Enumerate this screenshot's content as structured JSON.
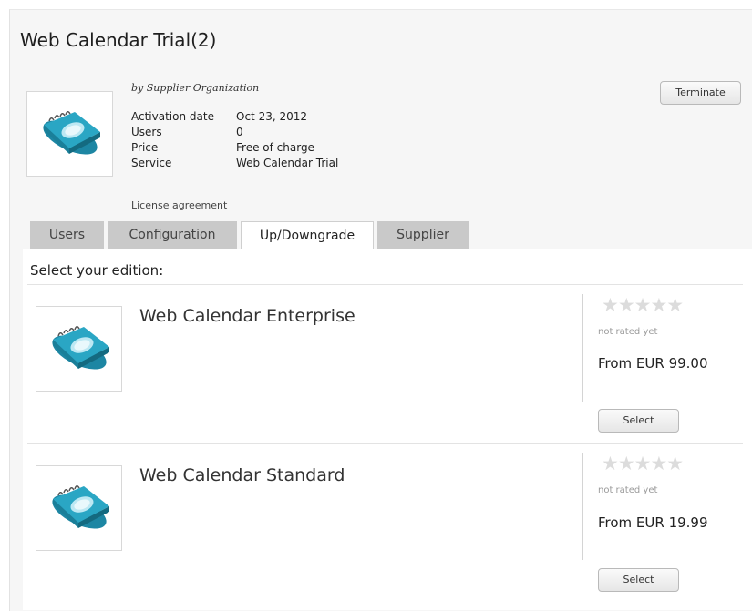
{
  "header": {
    "title": "Web Calendar Trial(2)"
  },
  "subscription": {
    "supplier_line": "by Supplier Organization",
    "fields": [
      {
        "label": "Activation date",
        "value": "Oct 23, 2012"
      },
      {
        "label": "Users",
        "value": "0"
      },
      {
        "label": "Price",
        "value": "Free of charge"
      },
      {
        "label": "Service",
        "value": "Web Calendar Trial"
      }
    ],
    "license_link": "License agreement",
    "terminate_label": "Terminate"
  },
  "tabs": [
    {
      "label": "Users",
      "active": false
    },
    {
      "label": "Configuration",
      "active": false
    },
    {
      "label": "Up/Downgrade",
      "active": true
    },
    {
      "label": "Supplier",
      "active": false
    }
  ],
  "editions": {
    "heading": "Select your edition:",
    "items": [
      {
        "name": "Web Calendar Enterprise",
        "rating_text": "not rated yet",
        "stars": "★★★★★",
        "price": "From EUR 99.00",
        "select_label": "Select"
      },
      {
        "name": "Web Calendar Standard",
        "rating_text": "not rated yet",
        "stars": "★★★★★",
        "price": "From EUR 19.99",
        "select_label": "Select"
      }
    ]
  },
  "colors": {
    "tab_inactive": "#c9c9c9",
    "icon_teal": "#2aa6c4",
    "star_empty": "#dcdcdc"
  }
}
